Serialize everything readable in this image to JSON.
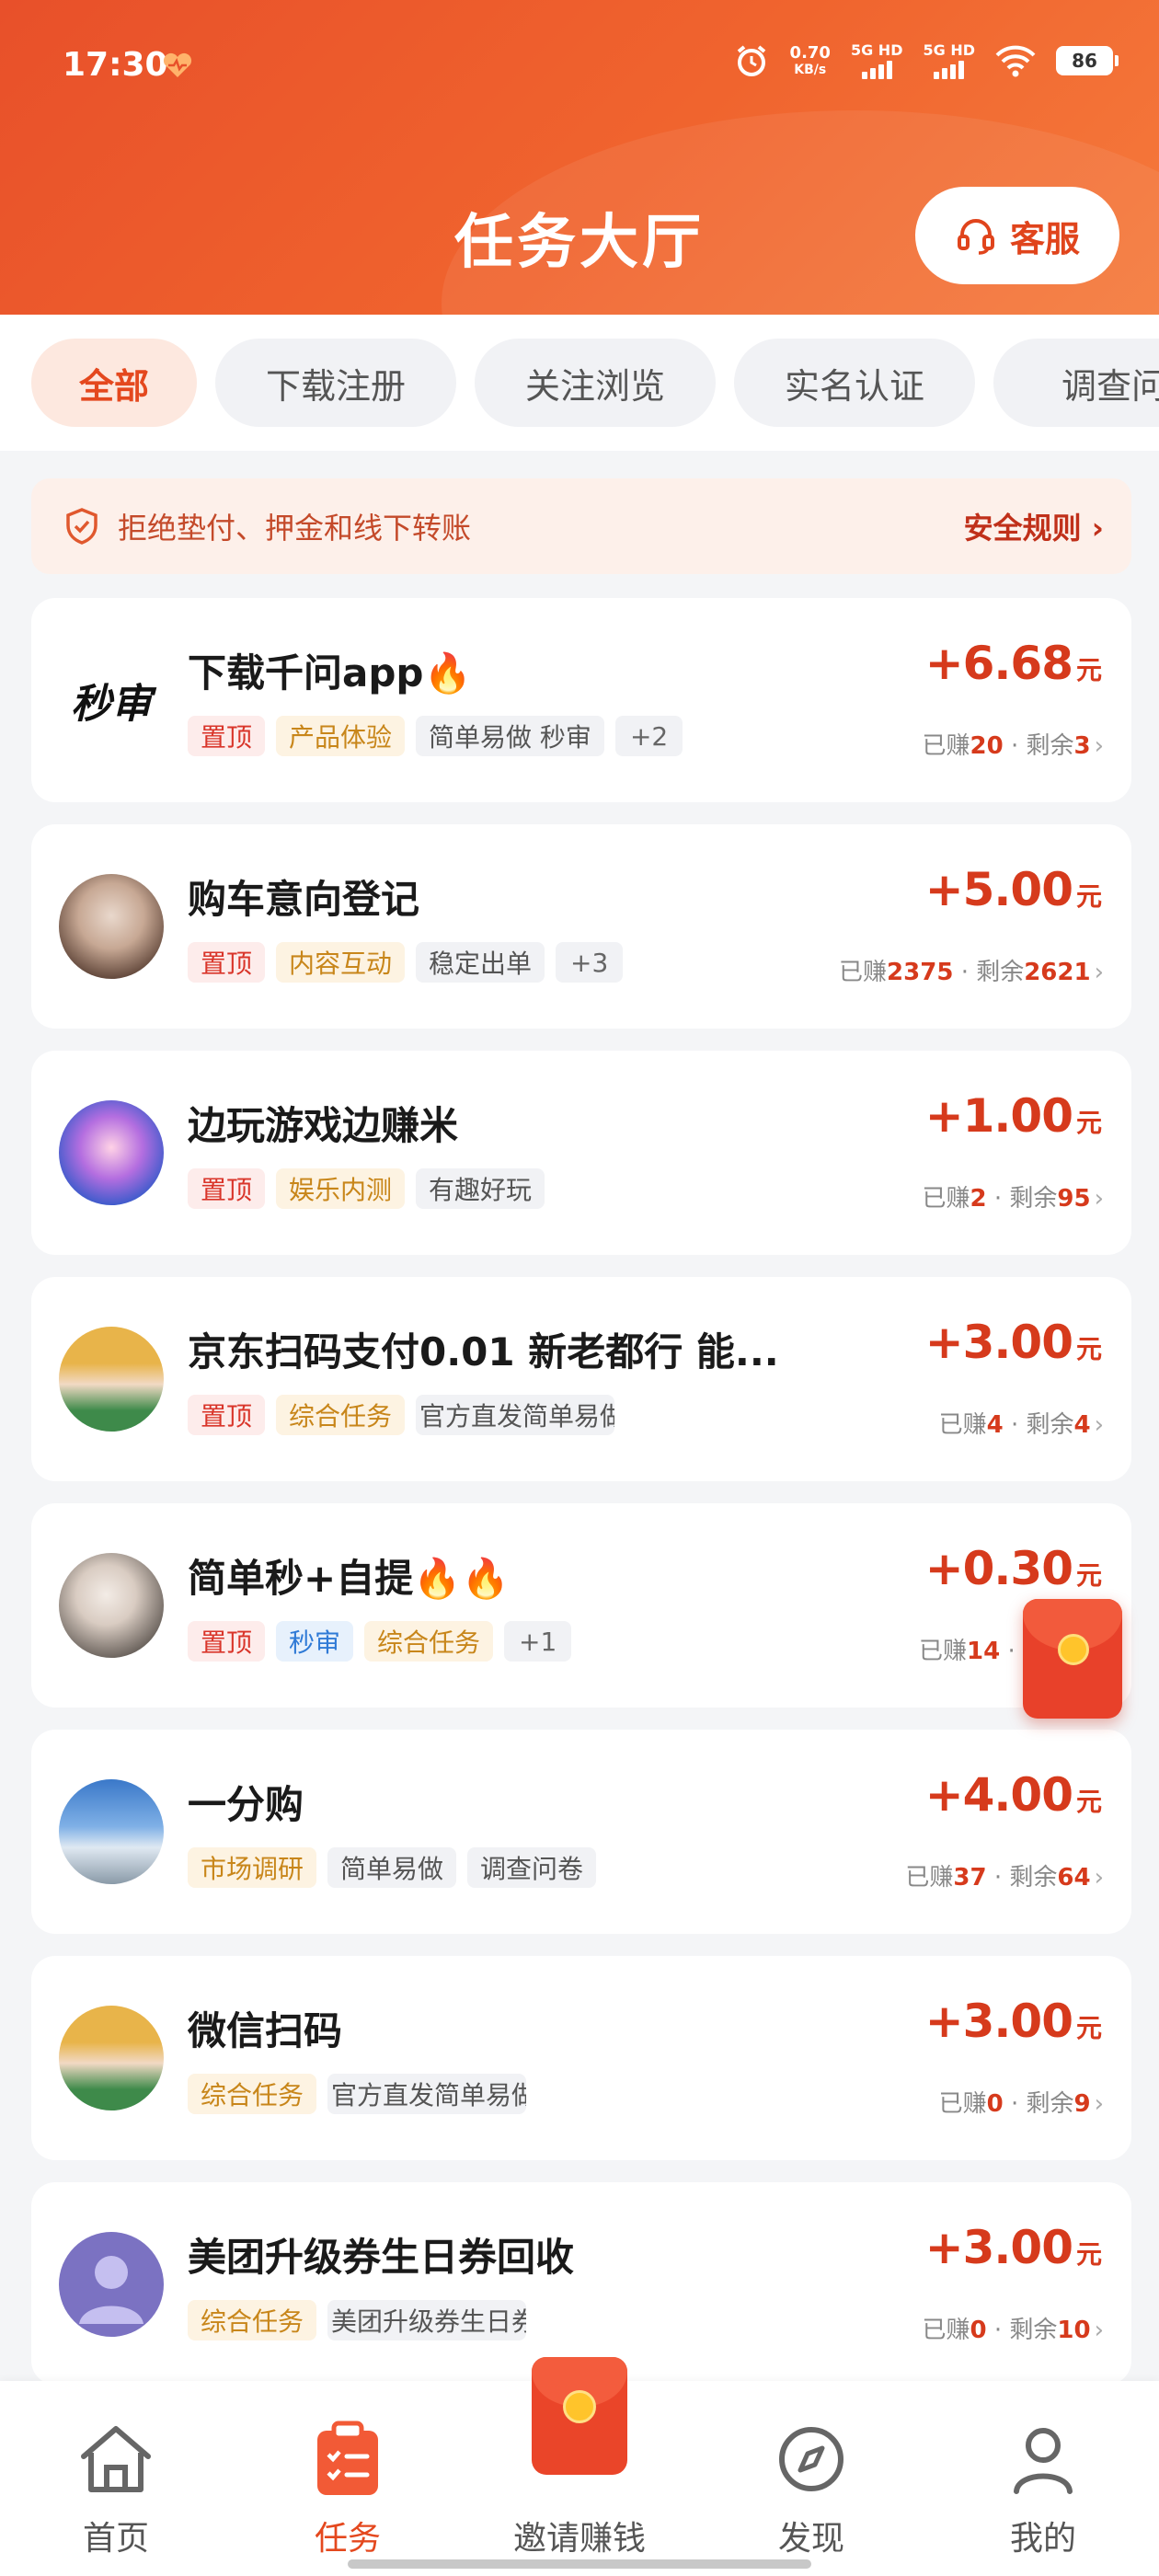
{
  "status_bar": {
    "time": "17:30",
    "net_speed_value": "0.70",
    "net_speed_unit": "KB/s",
    "signal1": "5G HD",
    "signal2": "5G HD",
    "battery": "86"
  },
  "header": {
    "title": "任务大厅",
    "service_label": "客服"
  },
  "tabs": [
    {
      "label": "全部",
      "active": true
    },
    {
      "label": "下载注册",
      "active": false
    },
    {
      "label": "关注浏览",
      "active": false
    },
    {
      "label": "实名认证",
      "active": false
    },
    {
      "label": "调查问",
      "active": false
    }
  ],
  "notice": {
    "text": "拒绝垫付、押金和线下转账",
    "link": "安全规则 ›"
  },
  "tasks": [
    {
      "title": "下载千问app🔥",
      "price": "+6.68",
      "unit": "元",
      "earned_label": "已赚",
      "earned": "20",
      "remain_label": "· 剩余",
      "remain": "3",
      "avatar_text": "秒审",
      "tags": [
        {
          "t": "置顶"
        },
        {
          "t": "产品体验"
        },
        {
          "t": "简单易做 秒审"
        },
        {
          "t": "+2"
        }
      ]
    },
    {
      "title": "购车意向登记",
      "price": "+5.00",
      "unit": "元",
      "earned_label": "已赚",
      "earned": "2375",
      "remain_label": "· 剩余",
      "remain": "2621",
      "tags": [
        {
          "t": "置顶"
        },
        {
          "t": "内容互动"
        },
        {
          "t": "稳定出单"
        },
        {
          "t": "+3"
        }
      ]
    },
    {
      "title": "边玩游戏边赚米",
      "price": "+1.00",
      "unit": "元",
      "earned_label": "已赚",
      "earned": "2",
      "remain_label": "· 剩余",
      "remain": "95",
      "tags": [
        {
          "t": "置顶"
        },
        {
          "t": "娱乐内测"
        },
        {
          "t": "有趣好玩"
        }
      ]
    },
    {
      "title": "京东扫码支付0.01 新老都行 能...",
      "price": "+3.00",
      "unit": "元",
      "earned_label": "已赚",
      "earned": "4",
      "remain_label": "· 剩余",
      "remain": "4",
      "tags": [
        {
          "t": "置顶"
        },
        {
          "t": "综合任务"
        },
        {
          "t": "官方直发简单易做"
        }
      ]
    },
    {
      "title": "简单秒+自提🔥🔥",
      "price": "+0.30",
      "unit": "元",
      "earned_label": "已赚",
      "earned": "14",
      "remain_label": "· 剩",
      "remain": "",
      "tags": [
        {
          "t": "置顶"
        },
        {
          "t": "秒审"
        },
        {
          "t": "综合任务"
        },
        {
          "t": "+1"
        }
      ]
    },
    {
      "title": "一分购",
      "price": "+4.00",
      "unit": "元",
      "earned_label": "已赚",
      "earned": "37",
      "remain_label": "· 剩余",
      "remain": "64",
      "tags": [
        {
          "t": "市场调研"
        },
        {
          "t": "简单易做"
        },
        {
          "t": "调查问卷"
        }
      ]
    },
    {
      "title": "微信扫码",
      "price": "+3.00",
      "unit": "元",
      "earned_label": "已赚",
      "earned": "0",
      "remain_label": "· 剩余",
      "remain": "9",
      "tags": [
        {
          "t": "综合任务"
        },
        {
          "t": "官方直发简单易做"
        }
      ]
    },
    {
      "title": "美团升级券生日券回收",
      "price": "+3.00",
      "unit": "元",
      "earned_label": "已赚",
      "earned": "0",
      "remain_label": "· 剩余",
      "remain": "10",
      "tags": [
        {
          "t": "综合任务"
        },
        {
          "t": "美团升级券生日券"
        }
      ]
    }
  ],
  "nav": [
    {
      "label": "首页"
    },
    {
      "label": "任务"
    },
    {
      "label": "邀请赚钱"
    },
    {
      "label": "发现"
    },
    {
      "label": "我的"
    }
  ],
  "colors": {
    "brand": "#e8502a",
    "price": "#d63a1c",
    "active_tab_bg": "#fde8df"
  },
  "icons": {
    "nav": [
      "home-icon",
      "clipboard-list-icon",
      "red-envelope-icon",
      "compass-icon",
      "user-icon"
    ],
    "service": "headset-icon",
    "notice": "shield-icon"
  }
}
